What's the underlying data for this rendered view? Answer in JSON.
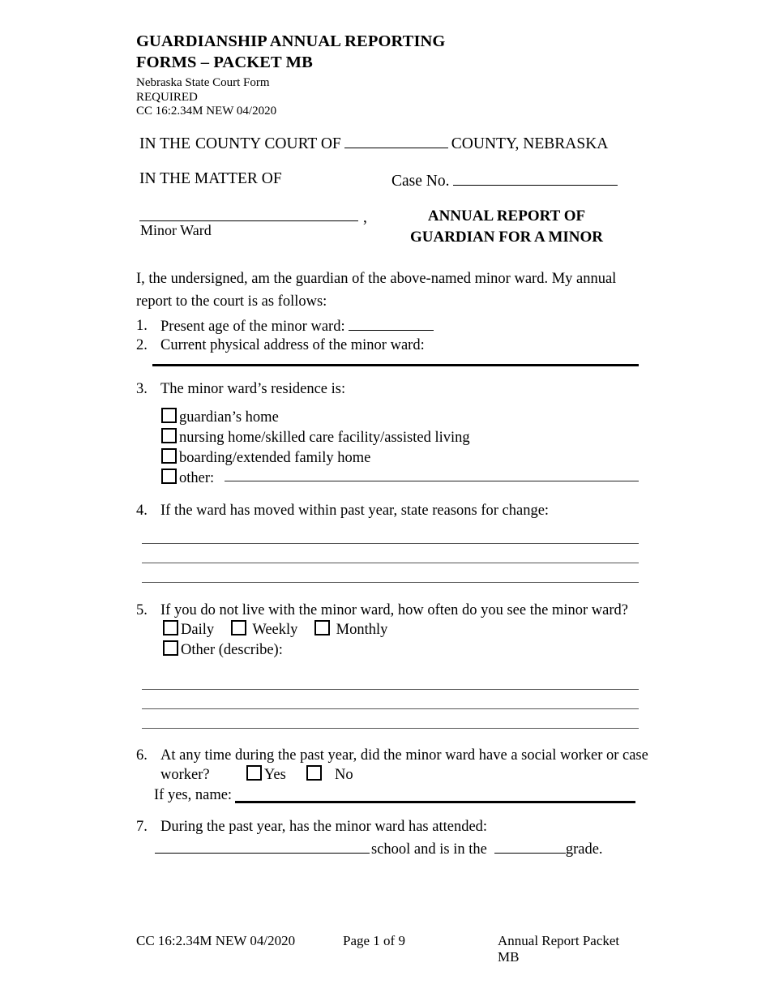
{
  "header": {
    "title_line1": "GUARDIANSHIP ANNUAL REPORTING",
    "title_line2": "FORMS – PACKET MB",
    "sub_line1": "Nebraska State Court Form",
    "sub_line2": "REQUIRED",
    "sub_line3": "CC 16:2.34M NEW 04/2020"
  },
  "caption": {
    "court_prefix": "IN THE",
    "court_middle": "COUNTY COURT OF",
    "court_suffix": "COUNTY, NEBRASKA",
    "matter_label": "IN THE MATTER OF",
    "case_no_label": "Case No.",
    "ward_comma": ",",
    "ward_label": "Minor Ward",
    "report_title_line1": "ANNUAL REPORT OF",
    "report_title_line2": "GUARDIAN FOR A MINOR"
  },
  "intro": "I, the undersigned, am the guardian of the above-named minor ward. My annual report to the court is as follows:",
  "items": [
    {
      "number": "1.",
      "text": "Present age of the minor ward:"
    },
    {
      "number": "2.",
      "text": "Current physical address of the minor ward:"
    },
    {
      "number": "3.",
      "text": "The minor ward’s residence is:",
      "options": [
        "guardian’s home",
        "nursing home/skilled care facility/assisted living",
        "boarding/extended family home",
        "other:"
      ]
    },
    {
      "number": "4.",
      "text": "If the ward has moved within past year, state reasons for change:"
    },
    {
      "number": "5.",
      "text": "If you do not live with the minor ward, how often do you see the minor ward?",
      "options": [
        "Daily",
        "Weekly",
        "Monthly",
        "Other (describe):"
      ]
    },
    {
      "number": "6.",
      "text_line1": "At any time during the past year, did the minor ward have a social worker or case",
      "text_line2": "worker?",
      "options": [
        "Yes",
        "No"
      ],
      "if_yes_label": "If yes, name:"
    },
    {
      "number": "7.",
      "text": "During the past year, has the minor ward has attended:",
      "school_label": "school and is in the",
      "grade_label": "grade."
    }
  ],
  "footer": {
    "left": "CC 16:2.34M NEW 04/2020",
    "center": "Page 1 of 9",
    "right": "Annual Report Packet MB"
  }
}
